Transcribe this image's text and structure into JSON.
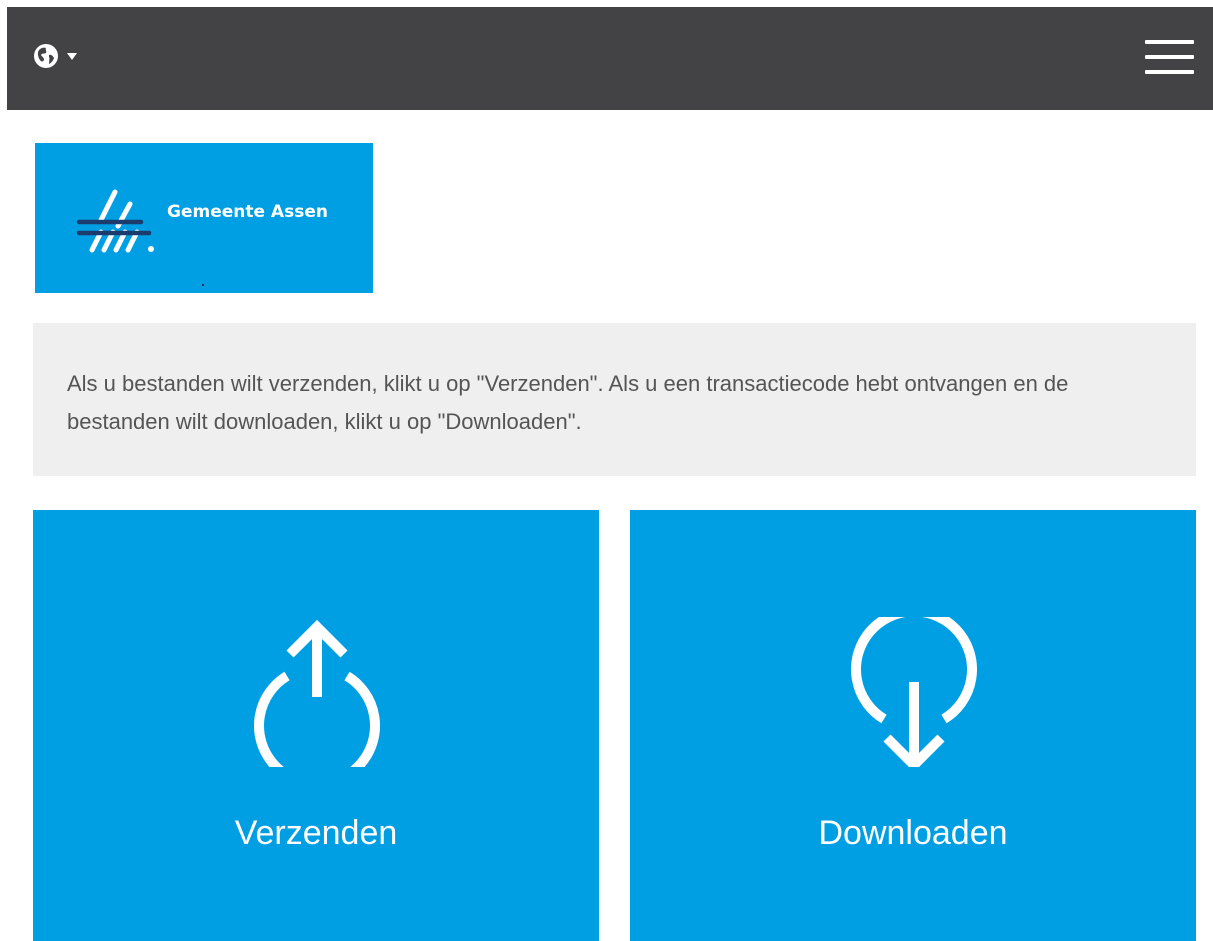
{
  "header": {
    "language_icon": "globe-icon",
    "language_dropdown_icon": "caret-down-icon",
    "menu_icon": "hamburger-menu-icon",
    "background_color": "#434345"
  },
  "logo": {
    "text": "Gemeente Assen",
    "background_color": "#009fe3"
  },
  "info": {
    "text": "Als u bestanden wilt verzenden, klikt u op \"Verzenden\". Als u een transactiecode hebt ontvangen en de bestanden wilt downloaden, klikt u op \"Downloaden\"."
  },
  "actions": {
    "send": {
      "label": "Verzenden",
      "icon": "upload-icon"
    },
    "download": {
      "label": "Downloaden",
      "icon": "download-icon"
    },
    "tile_color": "#009fe3"
  }
}
